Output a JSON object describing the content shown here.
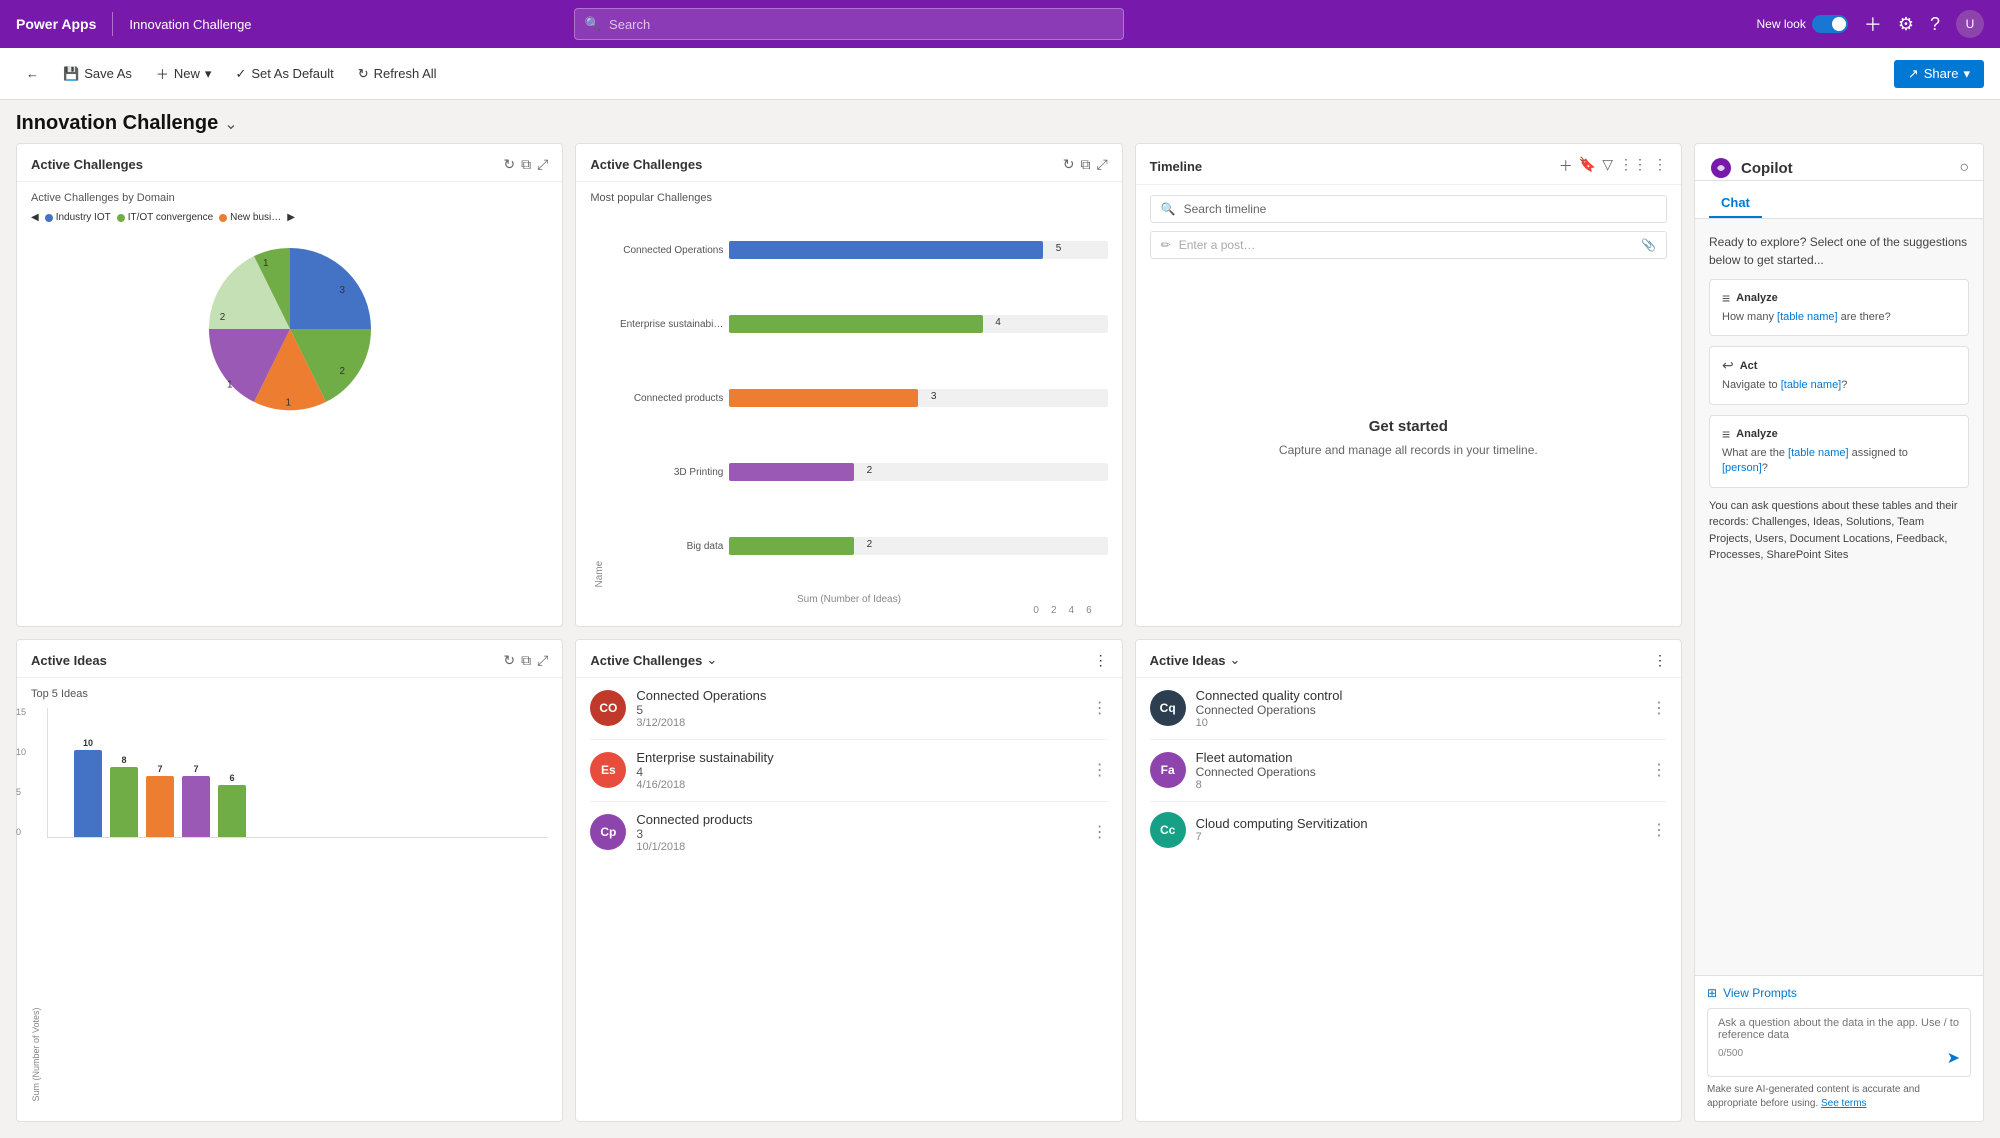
{
  "topNav": {
    "brand": "Power Apps",
    "divider": "|",
    "appName": "Innovation Challenge",
    "search_placeholder": "Search",
    "newLook": "New look",
    "icons": [
      "plus-icon",
      "settings-icon",
      "help-icon",
      "profile-icon"
    ]
  },
  "toolbar": {
    "saveAs": "Save As",
    "new": "New",
    "setAsDefault": "Set As Default",
    "refreshAll": "Refresh All",
    "share": "Share"
  },
  "pageTitle": "Innovation Challenge",
  "cards": {
    "activeChallengePie": {
      "title": "Active Challenges",
      "subtitle": "Active Challenges by Domain",
      "legend": [
        {
          "label": "Industry IOT",
          "color": "#4472c4"
        },
        {
          "label": "IT/OT convergence",
          "color": "#70ad47"
        },
        {
          "label": "New busi…",
          "color": "#ed7d31"
        }
      ],
      "values": [
        {
          "label": "2",
          "angle": 60,
          "color": "#4472c4"
        },
        {
          "label": "3",
          "angle": 72,
          "color": "#4472c4"
        },
        {
          "label": "1",
          "angle": 45,
          "color": "#9e86be"
        },
        {
          "label": "1",
          "angle": 55,
          "color": "#ed7d31"
        },
        {
          "label": "2",
          "angle": 60,
          "color": "#70ad47"
        },
        {
          "label": "1",
          "angle": 68,
          "color": "#c5e0b4"
        }
      ]
    },
    "activeChallengebar": {
      "title": "Active Challenges",
      "subtitle": "Most popular Challenges",
      "xLabel": "Sum (Number of Ideas)",
      "bars": [
        {
          "name": "Connected Operations",
          "value": 5,
          "color": "#4472c4"
        },
        {
          "name": "Enterprise sustainabi…",
          "value": 4,
          "color": "#70ad47"
        },
        {
          "name": "Connected products",
          "value": 3,
          "color": "#ed7d31"
        },
        {
          "name": "3D Printing",
          "value": 2,
          "color": "#9b59b6"
        },
        {
          "name": "Big data",
          "value": 2,
          "color": "#70ad47"
        }
      ],
      "maxValue": 6
    },
    "timeline": {
      "title": "Timeline",
      "searchPlaceholder": "Search timeline",
      "postPlaceholder": "Enter a post…",
      "emptyTitle": "Get started",
      "emptyText": "Capture and manage all records in your timeline."
    },
    "activeIdeas": {
      "title": "Active Ideas",
      "subtitle": "Top 5 Ideas",
      "bars": [
        {
          "value": 10,
          "color": "#4472c4"
        },
        {
          "value": 8,
          "color": "#70ad47"
        },
        {
          "value": 7,
          "color": "#ed7d31"
        },
        {
          "value": 7,
          "color": "#9b59b6"
        },
        {
          "value": 6,
          "color": "#70ad47"
        }
      ],
      "yLabels": [
        "0",
        "5",
        "10",
        "15"
      ],
      "yAxisLabel": "Sum (Number of Votes)"
    },
    "activeChallengeList": {
      "title": "Active Challenges",
      "items": [
        {
          "name": "Connected Operations",
          "count": "5",
          "date": "3/12/2018",
          "initials": "CO",
          "color": "#c0392b"
        },
        {
          "name": "Enterprise sustainability",
          "count": "4",
          "date": "4/16/2018",
          "initials": "Es",
          "color": "#e74c3c"
        },
        {
          "name": "Connected products",
          "count": "3",
          "date": "10/1/2018",
          "initials": "Cp",
          "color": "#8e44ad"
        }
      ]
    },
    "activeIdeasList": {
      "title": "Active Ideas",
      "items": [
        {
          "name": "Connected quality control",
          "subtitle": "Connected Operations",
          "count": "10",
          "initials": "Cq",
          "color": "#2c3e50"
        },
        {
          "name": "Fleet automation",
          "subtitle": "Connected Operations",
          "count": "8",
          "initials": "Fa",
          "color": "#8e44ad"
        },
        {
          "name": "Cloud computing Servitization",
          "subtitle": "",
          "count": "7",
          "initials": "Cc",
          "color": "#16a085"
        }
      ]
    }
  },
  "copilot": {
    "title": "Copilot",
    "tabs": [
      "Chat"
    ],
    "intro": "Ready to explore? Select one of the suggestions below to get started...",
    "suggestions": [
      {
        "type": "Analyze",
        "icon": "list-icon",
        "text": "How many [table name] are there?"
      },
      {
        "type": "Act",
        "icon": "reply-icon",
        "text": "Navigate to [table name]?"
      },
      {
        "type": "Analyze",
        "icon": "list-icon",
        "text": "What are the [table name] assigned to [person]?"
      }
    ],
    "tablesText": "You can ask questions about these tables and their records: Challenges, Ideas, Solutions, Team Projects, Users, Document Locations, Feedback, Processes, SharePoint Sites",
    "viewPrompts": "View Prompts",
    "inputPlaceholder": "Ask a question about the data in the app. Use / to reference data",
    "inputCount": "0/500",
    "disclaimer": "Make sure AI-generated content is accurate and appropriate before using.",
    "disclaimerLink": "See terms"
  }
}
